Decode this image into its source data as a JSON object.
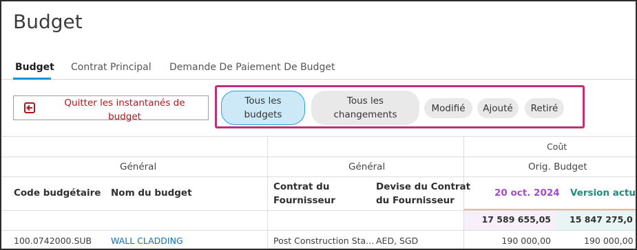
{
  "page": {
    "title": "Budget"
  },
  "tabs": [
    {
      "label": "Budget"
    },
    {
      "label": "Contrat Principal"
    },
    {
      "label": "Demande De Paiement De Budget"
    }
  ],
  "toolbar": {
    "quit_label_line1": "Quitter les instantanés de",
    "quit_label_line2": "budget",
    "quit_icon": "exit-icon",
    "filters": [
      {
        "line1": "Tous les",
        "line2": "budgets",
        "active": true
      },
      {
        "line1": "Tous les",
        "line2": "changements",
        "active": false
      },
      {
        "line1": "Modifié",
        "active": false
      },
      {
        "line1": "Ajouté",
        "active": false
      },
      {
        "line1": "Retiré",
        "active": false
      }
    ]
  },
  "table": {
    "group_cout": "Coût",
    "group_general_1": "Général",
    "group_general_2": "Général",
    "group_orig_budget": "Orig. Budget",
    "columns": {
      "code": "Code budgétaire",
      "name": "Nom du budget",
      "contract_line1": "Contrat du",
      "contract_line2": "Fournisseur",
      "currency_line1": "Devise du Contrat",
      "currency_line2": "du Fournisseur",
      "snapshot_date": "20 oct. 2024",
      "current_version": "Version actuell"
    },
    "totals": {
      "snapshot": "17 589 655,05",
      "current": "15 847 275,0"
    },
    "rows": [
      {
        "code": "100.0742000.SUB",
        "name": "WALL CLADDING",
        "contract": "Post Construction Sta...",
        "currency": "AED, SGD",
        "snapshot": "190 000,00",
        "current": "190 000,00"
      }
    ]
  },
  "colors": {
    "accent_blue": "#0696d7",
    "highlight_border": "#c0307a",
    "quit_text": "#b0151b",
    "snapshot_purple": "#a64ac9",
    "current_teal": "#1f8a7d"
  }
}
